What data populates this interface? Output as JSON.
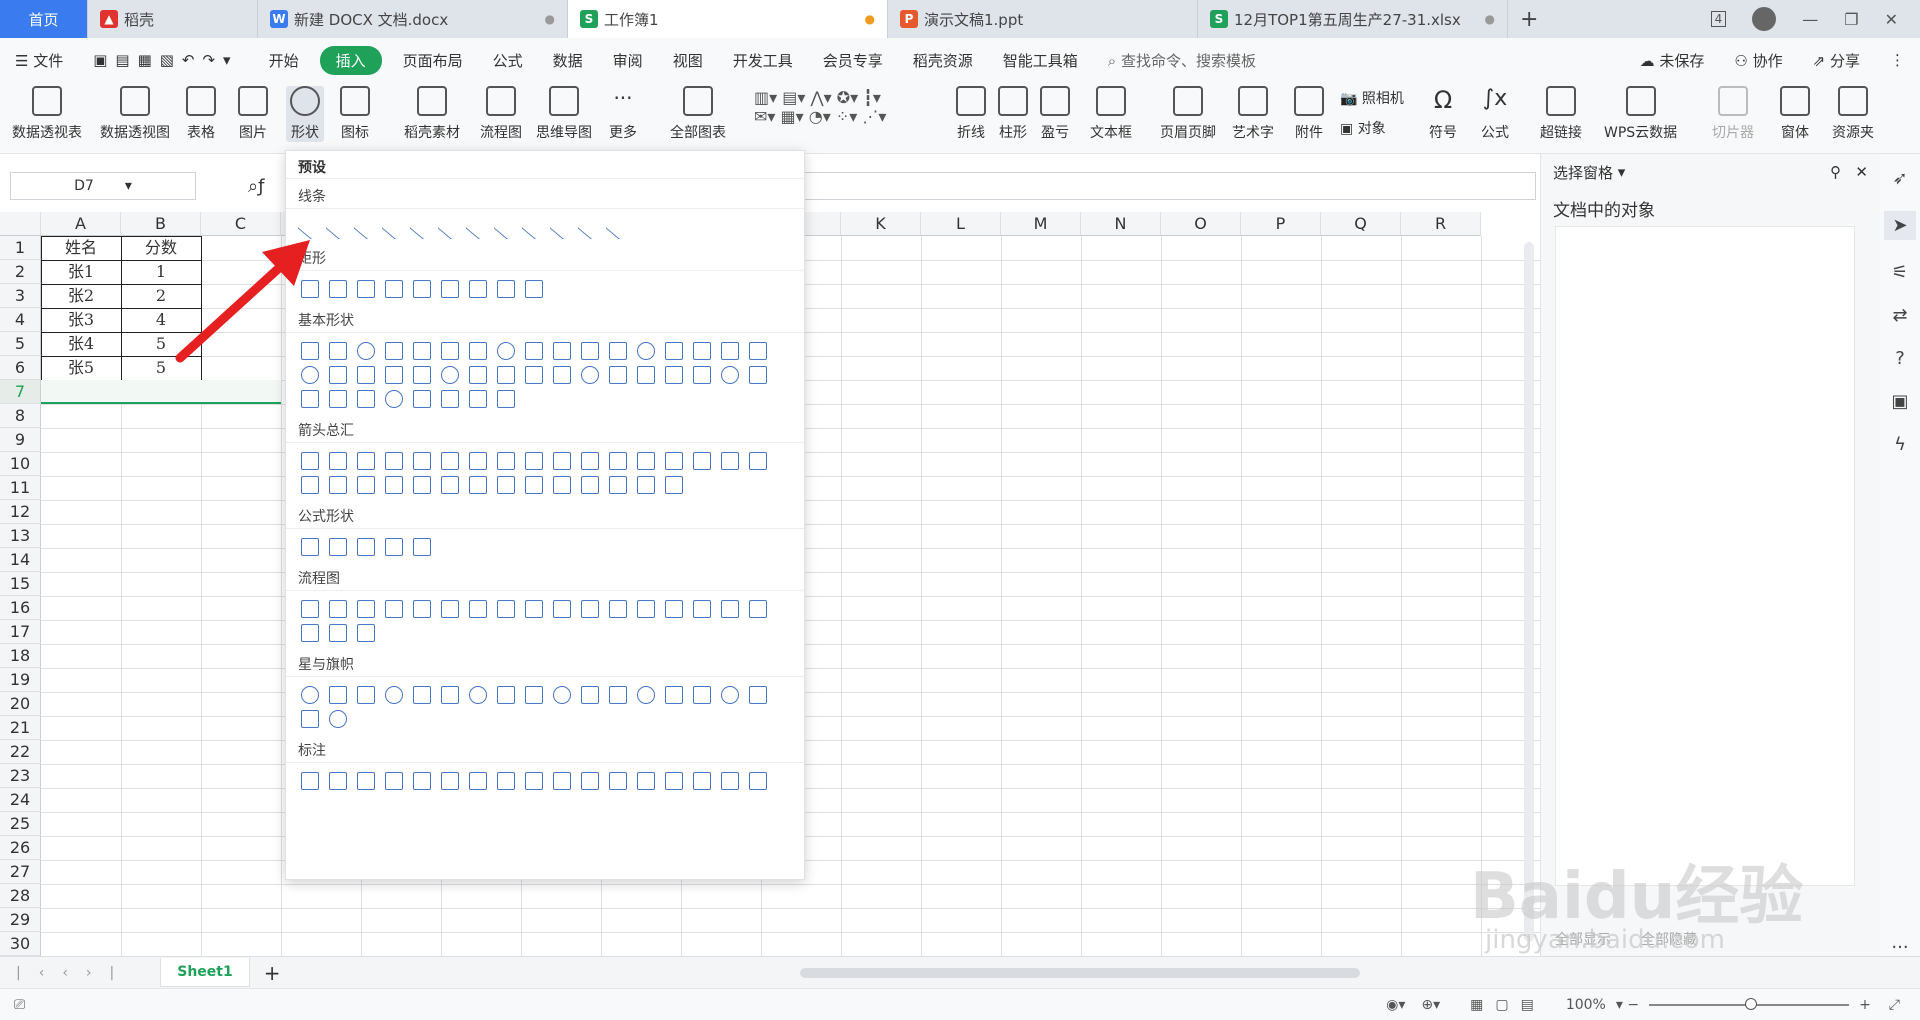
{
  "tabs": {
    "home": "首页",
    "daoke": "稻壳",
    "docx": "新建 DOCX 文档.docx",
    "workbook": "工作簿1",
    "ppt": "演示文稿1.ppt",
    "xlsx": "12月TOP1第五周生产27-31.xlsx",
    "add": "+",
    "count": "4"
  },
  "menu": {
    "file": "文件",
    "items": [
      "开始",
      "插入",
      "页面布局",
      "公式",
      "数据",
      "审阅",
      "视图",
      "开发工具",
      "会员专享",
      "稻壳资源",
      "智能工具箱"
    ],
    "active": "插入",
    "search": "查找命令、搜索模板",
    "unsaved": "未保存",
    "collab": "协作",
    "share": "分享"
  },
  "ribbon": [
    "数据透视表",
    "数据透视图",
    "表格",
    "图片",
    "形状",
    "图标",
    "稻壳素材",
    "流程图",
    "思维导图",
    "更多",
    "全部图表",
    "折线",
    "柱形",
    "盈亏",
    "文本框",
    "页眉页脚",
    "艺术字",
    "附件",
    "照相机",
    "对象",
    "符号",
    "公式",
    "超链接",
    "WPS云数据",
    "切片器",
    "窗体",
    "资源夹"
  ],
  "namebox": "D7",
  "columns": [
    "A",
    "B",
    "C",
    "D",
    "E",
    "F",
    "G",
    "H",
    "I",
    "J",
    "K",
    "L",
    "M",
    "N",
    "O",
    "P",
    "Q",
    "R"
  ],
  "rows": [
    "1",
    "2",
    "3",
    "4",
    "5",
    "6",
    "7",
    "8",
    "9",
    "10",
    "11",
    "12",
    "13",
    "14",
    "15",
    "16",
    "17",
    "18",
    "19",
    "20",
    "21",
    "22",
    "23",
    "24",
    "25",
    "26",
    "27",
    "28",
    "29",
    "30"
  ],
  "table": [
    [
      "姓名",
      "分数"
    ],
    [
      "张1",
      "1"
    ],
    [
      "张2",
      "2"
    ],
    [
      "张3",
      "4"
    ],
    [
      "张4",
      "5"
    ],
    [
      "张5",
      "5"
    ]
  ],
  "dropdown": {
    "preset": "预设",
    "sections": [
      "线条",
      "矩形",
      "基本形状",
      "箭头总汇",
      "公式形状",
      "流程图",
      "星与旗帜",
      "标注"
    ]
  },
  "rightpane": {
    "title": "选择窗格",
    "objects": "文档中的对象",
    "show_all": "全部显示",
    "hide_all": "全部隐藏"
  },
  "sheet": {
    "name": "Sheet1"
  },
  "status": {
    "zoom": "100%"
  },
  "watermark": {
    "main": "Baidu经验",
    "sub": "jingyan.baidu.com"
  }
}
